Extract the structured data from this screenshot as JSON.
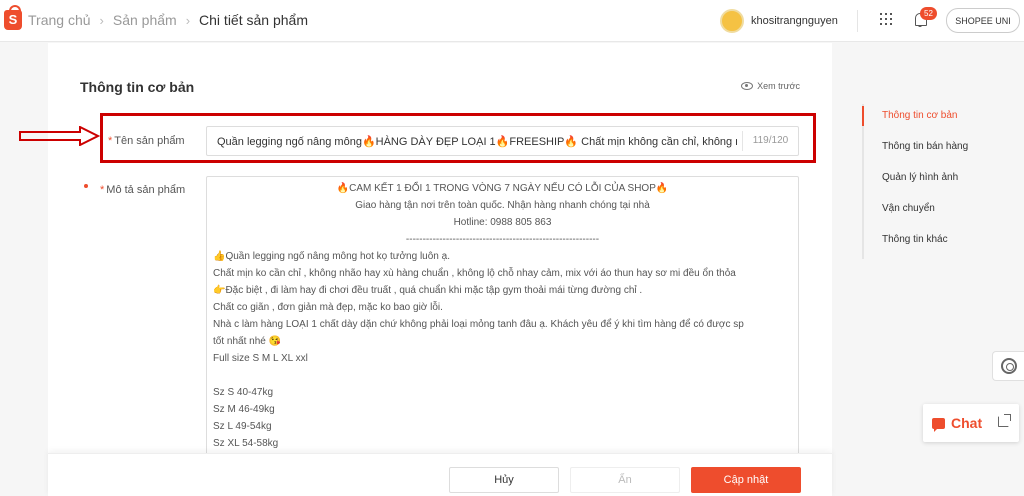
{
  "header": {
    "breadcrumbs": [
      "Trang chủ",
      "Sản phẩm",
      "Chi tiết sản phẩm"
    ],
    "username": "khositrangnguyen",
    "notification_count": "52",
    "shopee_uni_label": "SHOPEE UNI"
  },
  "basic_info": {
    "title": "Thông tin cơ bản",
    "preview_label": "Xem trước",
    "product_name_label": "Tên sản phẩm",
    "product_name_value": "Quần legging ngố nâng mông🔥HÀNG DÀY ĐẸP LOẠI 1🔥FREESHIP🔥 Chất mịn không cần chỉ, không nhão",
    "product_name_count": "119/120",
    "description_label": "Mô tả sản phẩm",
    "description": {
      "line1": "🔥CAM KẾT 1 ĐỔI 1 TRONG VÒNG 7 NGÀY NẾU CÓ LỖI CỦA SHOP🔥",
      "line2": "Giao hàng tận nơi trên toàn quốc. Nhận hàng nhanh chóng tại nhà",
      "line3": "Hotline: 0988 805 863",
      "line4": "----------------------------------------------------------",
      "line5": "👍Quần legging ngố nâng mông hot kọ tưởng luôn ạ.",
      "line6": "Chất mịn ko cần chỉ , không nhão hay xù hàng chuẩn , không lộ chỗ nhay cảm, mix với áo thun hay sơ mi đều ổn thỏa",
      "line7": "👉Đặc biệt , đi làm hay đi chơi đều truất , quá chuẩn khi mặc tập gym thoải mái từng đường chỉ .",
      "line8": "Chất co giãn , đơn giản mà đẹp, mặc ko bao giờ lỗi.",
      "line9": "Nhà c làm hàng LOẠI 1 chất dày dặn chứ không phải loại mỏng tanh đâu ạ. Khách yêu để ý khi tìm hàng để có được sp",
      "line10": "tốt nhất nhé 😘",
      "line11": "Full size S M L XL xxl",
      "line12": "Sz S 40-47kg",
      "line13": "Sz M 46-49kg",
      "line14": "Sz L 49-54kg",
      "line15": "Sz XL 54-58kg"
    }
  },
  "footer": {
    "cancel_label": "Hủy",
    "hide_label": "Ẩn",
    "update_label": "Cập nhật"
  },
  "side_nav": {
    "items": [
      {
        "label": "Thông tin cơ bản"
      },
      {
        "label": "Thông tin bán hàng"
      },
      {
        "label": "Quản lý hình ảnh"
      },
      {
        "label": "Vận chuyển"
      },
      {
        "label": "Thông tin khác"
      }
    ]
  },
  "chat": {
    "label": "Chat"
  },
  "colors": {
    "brand": "#ee4d2d",
    "annotation": "#cc0000"
  }
}
